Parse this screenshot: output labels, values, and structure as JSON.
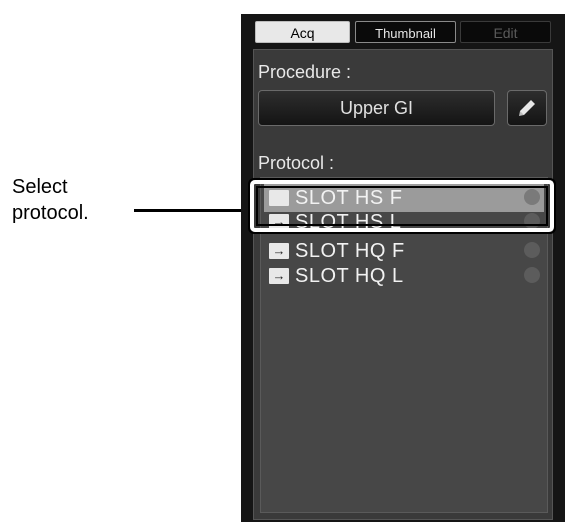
{
  "callout": {
    "line1": "Select",
    "line2": "protocol."
  },
  "tabs": [
    {
      "label": "Acq",
      "state": "active"
    },
    {
      "label": "Thumbnail",
      "state": "normal"
    },
    {
      "label": "Edit",
      "state": "disabled"
    }
  ],
  "procedure": {
    "label": "Procedure :",
    "value": "Upper GI",
    "edit_icon": "pencil-icon"
  },
  "protocol": {
    "label": "Protocol :",
    "items": [
      {
        "name": "SLOT HS F",
        "selected": true,
        "icon": "checkbox-icon"
      },
      {
        "name": "SLOT HS L",
        "selected": false,
        "icon": "arrow-right-icon"
      },
      {
        "name": "SLOT HQ F",
        "selected": false,
        "icon": "arrow-right-icon"
      },
      {
        "name": "SLOT HQ L",
        "selected": false,
        "icon": "arrow-right-icon"
      }
    ]
  },
  "colors": {
    "panel_bg": "#151515",
    "content_bg": "#3a3a3a",
    "selected_row": "#9b9b9b",
    "highlight_border": "#ffffff"
  }
}
